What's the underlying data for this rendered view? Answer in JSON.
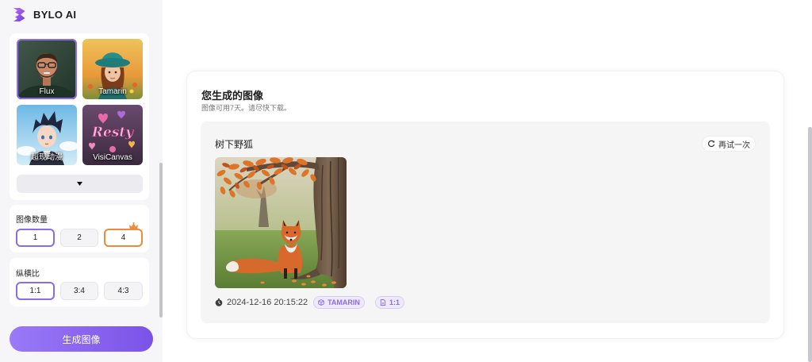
{
  "app": {
    "name": "BYLO AI",
    "logo_icon": "bylo-logo-icon"
  },
  "sidebar": {
    "models": [
      {
        "label": "Flux",
        "selected": true
      },
      {
        "label": "Tamarin",
        "selected": false
      },
      {
        "label": "超现动漫",
        "selected": false
      },
      {
        "label": "VisiCanvas",
        "selected": false,
        "artwork_text": "Resty"
      }
    ],
    "more_models_icon": "caret-down-icon",
    "image_count": {
      "title": "图像数量",
      "options": [
        {
          "label": "1",
          "selected": true,
          "premium": false
        },
        {
          "label": "2",
          "selected": false,
          "premium": false
        },
        {
          "label": "4",
          "selected": false,
          "premium": true
        }
      ],
      "premium_icon": "crown-icon"
    },
    "aspect_ratio": {
      "title": "纵横比",
      "options": [
        {
          "label": "1:1",
          "selected": true
        },
        {
          "label": "3:4",
          "selected": false
        },
        {
          "label": "4:3",
          "selected": false
        }
      ]
    },
    "generate_label": "生成图像"
  },
  "results": {
    "title": "您生成的图像",
    "subtitle": "图像可用7天。请尽快下载。",
    "items": [
      {
        "prompt": "树下野狐",
        "retry_label": "再试一次",
        "retry_icon": "refresh-icon",
        "timestamp": "2024-12-16 20:15:22",
        "timestamp_icon": "clock-icon",
        "model_badge": "TAMARIN",
        "model_badge_icon": "cube-icon",
        "ratio_badge": "1:1",
        "ratio_badge_icon": "file-icon"
      }
    ]
  },
  "colors": {
    "accent": "#8b6ce6",
    "premium": "#ef8a3a",
    "generate_gradient_start": "#9a7af7",
    "generate_gradient_end": "#7b52e8",
    "badge_bg": "#efe9fd"
  }
}
